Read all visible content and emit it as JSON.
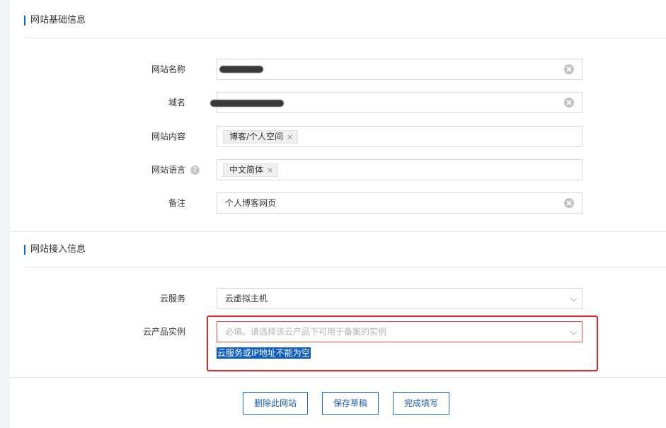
{
  "sections": {
    "basic": {
      "title": "网站基础信息"
    },
    "access": {
      "title": "网站接入信息"
    }
  },
  "fields": {
    "site_name": {
      "label": "网站名称"
    },
    "domain": {
      "label": "域名"
    },
    "content": {
      "label": "网站内容",
      "tag": "博客/个人空间"
    },
    "language": {
      "label": "网站语言",
      "tag": "中文简体",
      "help": "?"
    },
    "remark": {
      "label": "备注",
      "value": "个人博客网页"
    },
    "cloud_service": {
      "label": "云服务",
      "value": "云虚拟主机"
    },
    "cloud_instance": {
      "label": "云产品实例",
      "placeholder": "必填。请选择该云产品下可用于备案的实例",
      "error": "云服务或IP地址不能为空"
    }
  },
  "buttons": {
    "delete": "删除此网站",
    "save_draft": "保存草稿",
    "finish": "完成填写"
  },
  "tag_close_glyph": "×",
  "colors": {
    "accent": "#0070cc",
    "error_border": "#e8242a",
    "selection": "#0d5ec4"
  }
}
